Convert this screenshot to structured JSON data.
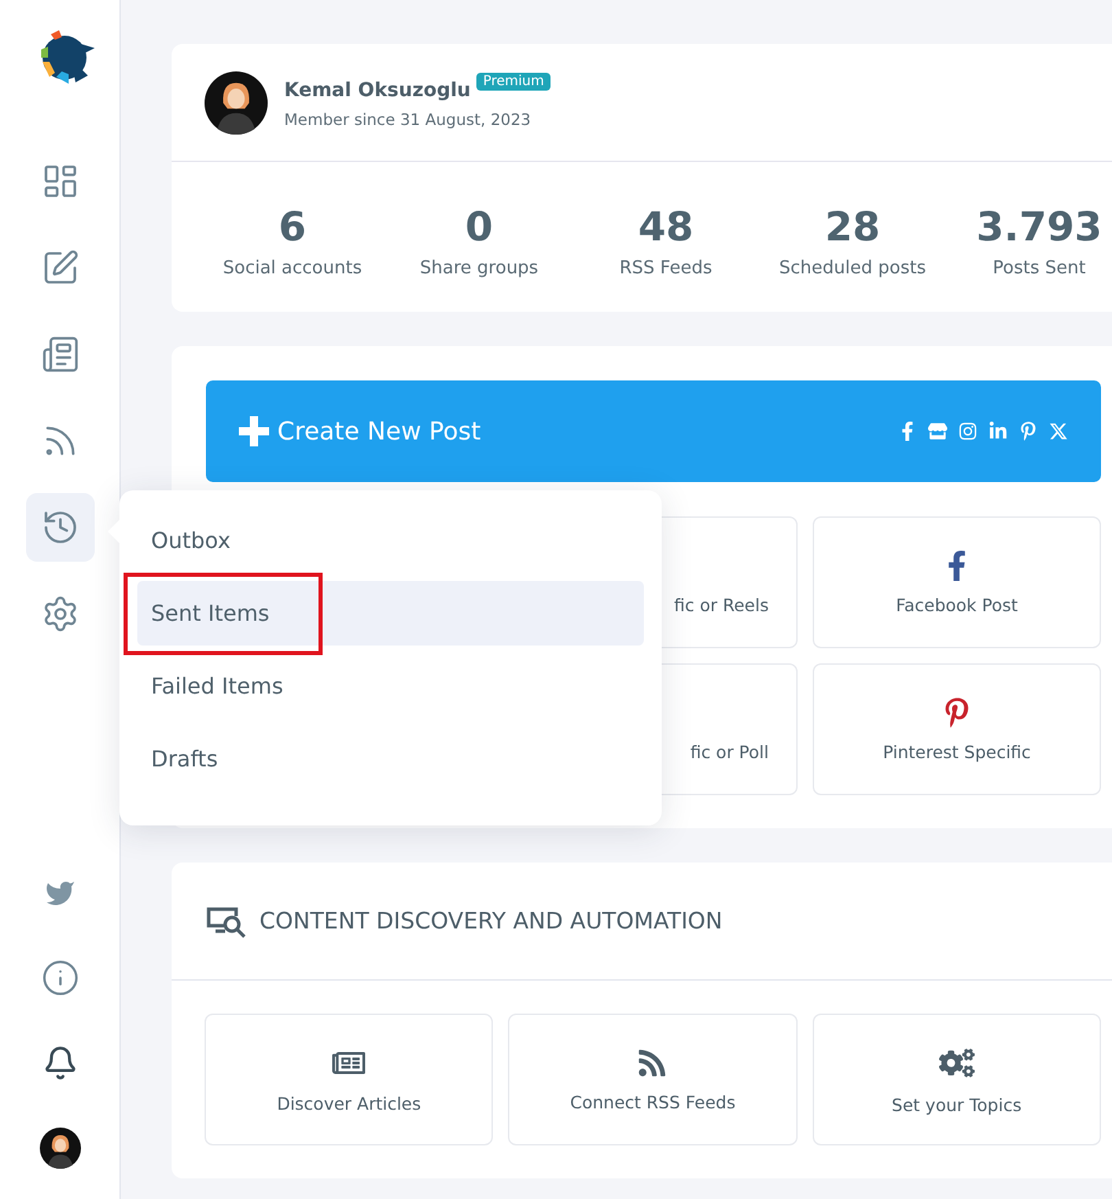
{
  "sidebar": {
    "items": [
      {
        "selected": false
      },
      {
        "selected": false
      },
      {
        "selected": false
      },
      {
        "selected": false
      },
      {
        "selected": true
      },
      {
        "selected": false
      }
    ],
    "bottom_items": [
      {
        "kind": "twitter"
      },
      {
        "kind": "info"
      },
      {
        "kind": "bell"
      },
      {
        "kind": "avatar"
      }
    ]
  },
  "profile": {
    "name": "Kemal Oksuzoglu",
    "badge": "Premium",
    "member_since": "Member since 31 August, 2023",
    "stats": [
      {
        "value": "6",
        "label": "Social accounts"
      },
      {
        "value": "0",
        "label": "Share groups"
      },
      {
        "value": "48",
        "label": "RSS Feeds"
      },
      {
        "value": "28",
        "label": "Scheduled posts"
      },
      {
        "value": "3.793",
        "label": "Posts Sent"
      }
    ]
  },
  "create_post": {
    "button": "Create New Post",
    "tiles": [
      {
        "label": "fic or Reels",
        "kind": "partial"
      },
      {
        "label": "Facebook Post",
        "kind": "facebook"
      },
      {
        "label": "fic or Poll",
        "kind": "partial"
      },
      {
        "label": "Pinterest Specific",
        "kind": "pinterest"
      }
    ]
  },
  "discovery": {
    "title": "CONTENT DISCOVERY AND AUTOMATION",
    "tiles": [
      {
        "label": "Discover Articles",
        "kind": "articles"
      },
      {
        "label": "Connect RSS Feeds",
        "kind": "rss"
      },
      {
        "label": "Set your Topics",
        "kind": "topics"
      }
    ]
  },
  "menu": {
    "items": [
      {
        "label": "Outbox",
        "selected": false,
        "annotated": false
      },
      {
        "label": "Sent Items",
        "selected": true,
        "annotated": true
      },
      {
        "label": "Failed Items",
        "selected": false,
        "annotated": false
      },
      {
        "label": "Drafts",
        "selected": false,
        "annotated": false
      }
    ]
  }
}
